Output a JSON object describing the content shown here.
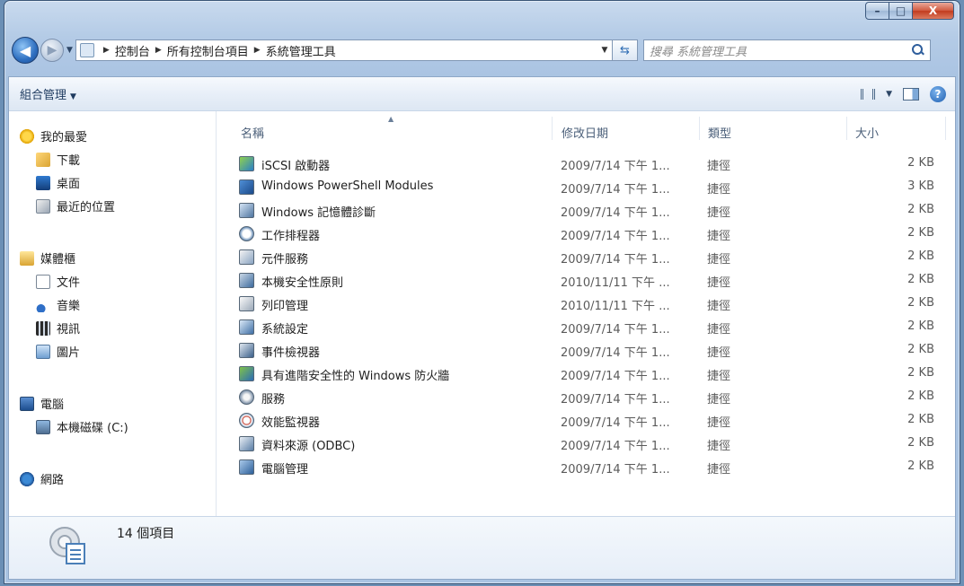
{
  "window": {
    "caption_buttons": {
      "minimize": "–",
      "maximize": "□",
      "close": "X"
    }
  },
  "navigation": {
    "back_glyph": "◀",
    "forward_glyph": "▶",
    "breadcrumbs": [
      "控制台",
      "所有控制台項目",
      "系統管理工具"
    ],
    "search_placeholder": "搜尋 系統管理工具"
  },
  "toolbar": {
    "organize_label": "組合管理",
    "help_glyph": "?"
  },
  "sidebar": {
    "favorites": {
      "label": "我的最愛",
      "items": [
        "下載",
        "桌面",
        "最近的位置"
      ]
    },
    "libraries": {
      "label": "媒體櫃",
      "items": [
        "文件",
        "音樂",
        "視訊",
        "圖片"
      ]
    },
    "computer": {
      "label": "電腦",
      "items": [
        "本機磁碟 (C:)"
      ]
    },
    "network": {
      "label": "網路"
    }
  },
  "columns": {
    "name": "名稱",
    "date": "修改日期",
    "type": "類型",
    "size": "大小"
  },
  "files": [
    {
      "name": "iSCSI 啟動器",
      "date": "2009/7/14 下午 1...",
      "type": "捷徑",
      "size": "2 KB"
    },
    {
      "name": "Windows PowerShell Modules",
      "date": "2009/7/14 下午 1...",
      "type": "捷徑",
      "size": "3 KB"
    },
    {
      "name": "Windows 記憶體診斷",
      "date": "2009/7/14 下午 1...",
      "type": "捷徑",
      "size": "2 KB"
    },
    {
      "name": "工作排程器",
      "date": "2009/7/14 下午 1...",
      "type": "捷徑",
      "size": "2 KB"
    },
    {
      "name": "元件服務",
      "date": "2009/7/14 下午 1...",
      "type": "捷徑",
      "size": "2 KB"
    },
    {
      "name": "本機安全性原則",
      "date": "2010/11/11 下午 ...",
      "type": "捷徑",
      "size": "2 KB"
    },
    {
      "name": "列印管理",
      "date": "2010/11/11 下午 ...",
      "type": "捷徑",
      "size": "2 KB"
    },
    {
      "name": "系統設定",
      "date": "2009/7/14 下午 1...",
      "type": "捷徑",
      "size": "2 KB"
    },
    {
      "name": "事件檢視器",
      "date": "2009/7/14 下午 1...",
      "type": "捷徑",
      "size": "2 KB"
    },
    {
      "name": "具有進階安全性的 Windows 防火牆",
      "date": "2009/7/14 下午 1...",
      "type": "捷徑",
      "size": "2 KB"
    },
    {
      "name": "服務",
      "date": "2009/7/14 下午 1...",
      "type": "捷徑",
      "size": "2 KB"
    },
    {
      "name": "效能監視器",
      "date": "2009/7/14 下午 1...",
      "type": "捷徑",
      "size": "2 KB"
    },
    {
      "name": "資料來源 (ODBC)",
      "date": "2009/7/14 下午 1...",
      "type": "捷徑",
      "size": "2 KB"
    },
    {
      "name": "電腦管理",
      "date": "2009/7/14 下午 1...",
      "type": "捷徑",
      "size": "2 KB"
    }
  ],
  "status": {
    "item_count": "14 個項目"
  },
  "colors": {
    "accent": "#2e6fc0",
    "close": "#c23c1f",
    "frame": "#a9c3e2"
  }
}
